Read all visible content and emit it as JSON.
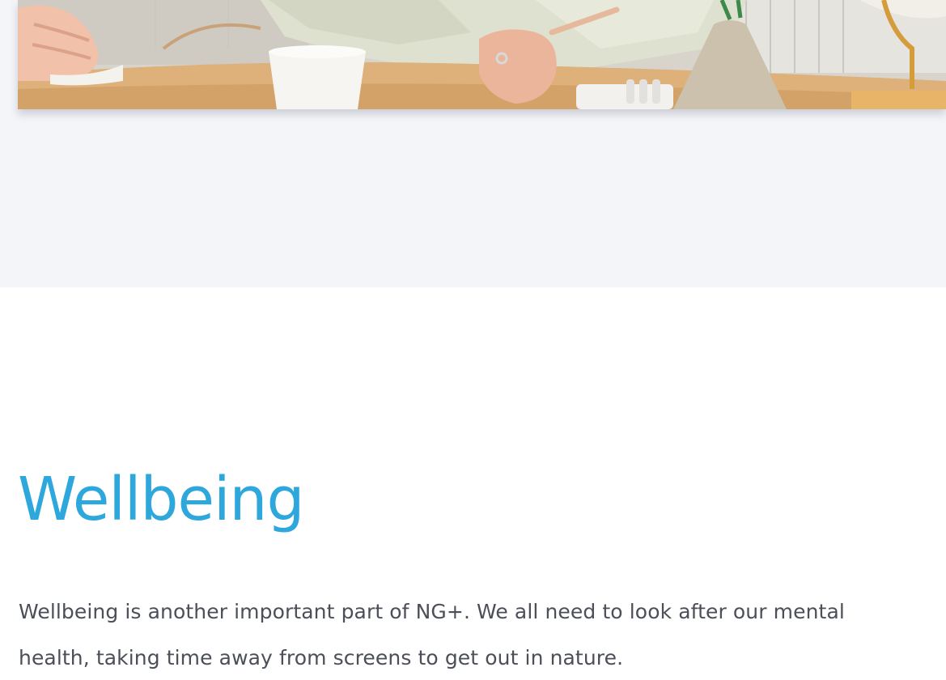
{
  "hero": {
    "image_icon": "photo-desk-meeting-image"
  },
  "wellbeing": {
    "title": "Wellbeing",
    "body": "Wellbeing is another important part of NG+. We all need to look after our mental health, taking time away from screens to get out in nature."
  },
  "colors": {
    "title_blue": "#2ea7dd",
    "body_text": "#4b4f58",
    "band_grey": "#f4f5f9"
  }
}
